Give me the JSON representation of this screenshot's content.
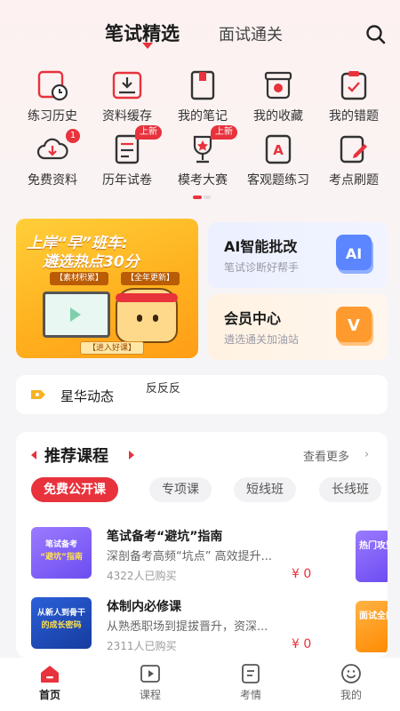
{
  "header": {
    "tab_active": "笔试精选",
    "tab_other": "面试通关"
  },
  "quick_grid": [
    {
      "label": "练习历史",
      "icon": "history-clock-icon"
    },
    {
      "label": "资料缓存",
      "icon": "download-tray-icon"
    },
    {
      "label": "我的笔记",
      "icon": "notebook-icon"
    },
    {
      "label": "我的收藏",
      "icon": "favorite-box-icon"
    },
    {
      "label": "我的错题",
      "icon": "mistake-clipboard-icon"
    },
    {
      "label": "免费资料",
      "icon": "cloud-download-icon",
      "badge": "1"
    },
    {
      "label": "历年试卷",
      "icon": "exam-paper-icon",
      "badge": "上新"
    },
    {
      "label": "模考大赛",
      "icon": "trophy-icon",
      "badge": "上新"
    },
    {
      "label": "客观题练习",
      "icon": "objective-a-icon"
    },
    {
      "label": "考点刷题",
      "icon": "edit-note-icon"
    }
  ],
  "banner": {
    "title_line1": "上岸“早”班车:",
    "title_line2": "遴选热点30分",
    "tag1": "【素材积累】",
    "tag2": "【全年更新】",
    "cta": "【进入好课】"
  },
  "ai_card": {
    "title": "AI智能批改",
    "subtitle": "笔试诊断好帮手",
    "art_text": "AI"
  },
  "vip_card": {
    "title": "会员中心",
    "subtitle": "遴选通关加油站",
    "art_text": "V"
  },
  "news": {
    "title": "星华动态",
    "text": "反反反"
  },
  "recommend": {
    "title": "推荐课程",
    "more": "查看更多",
    "chips": [
      "免费公开课",
      "专项课",
      "短线班",
      "长线班"
    ],
    "courses": [
      {
        "cover_line1": "笔试备考",
        "cover_line2": "“避坑”指南",
        "title": "笔试备考“避坑”指南",
        "desc": "深剖备考高频“坑点” 高效提升...",
        "buyers": "4322人已购买",
        "price": "¥ 0",
        "peek": "热门攻坚"
      },
      {
        "cover_line1": "从新人到骨干",
        "cover_line2": "的成长密码",
        "title": "体制内必修课",
        "desc": "从熟悉职场到提拔晋升，资深...",
        "buyers": "2311人已购买",
        "price": "¥ 0",
        "peek": "面试全能"
      }
    ]
  },
  "tabbar": [
    {
      "label": "首页",
      "icon": "home-icon"
    },
    {
      "label": "课程",
      "icon": "play-video-icon"
    },
    {
      "label": "考情",
      "icon": "document-icon"
    },
    {
      "label": "我的",
      "icon": "profile-face-icon"
    }
  ],
  "colors": {
    "accent": "#e8323c",
    "banner_yellow": "#ffb11f"
  }
}
